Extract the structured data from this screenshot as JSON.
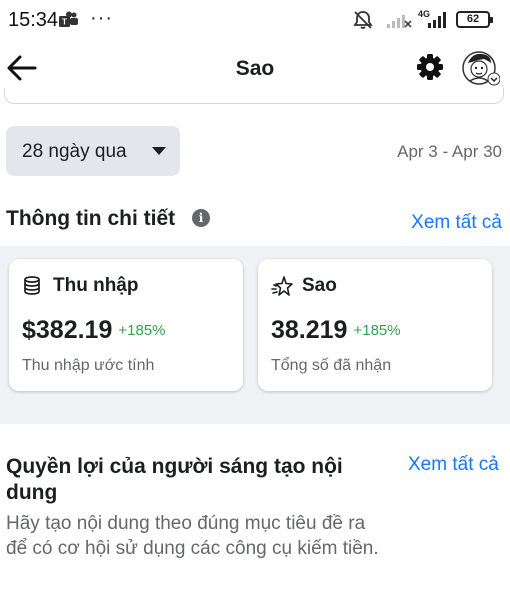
{
  "status_bar": {
    "time": "15:34",
    "dots": "···",
    "network": "4G",
    "battery": "62"
  },
  "header": {
    "title": "Sao",
    "icons": [
      "back-arrow-icon",
      "gear-icon",
      "avatar"
    ]
  },
  "filter": {
    "period_label": "28 ngày qua",
    "date_range": "Apr 3 - Apr 30"
  },
  "insights": {
    "title": "Thông tin chi tiết",
    "info_icon": "i",
    "see_all": "Xem tất cả",
    "cards": [
      {
        "icon": "money-stack-icon",
        "title": "Thu nhập",
        "value": "$382.19",
        "delta": "+185%",
        "subtitle": "Thu nhập ước tính"
      },
      {
        "icon": "star-icon",
        "title": "Sao",
        "value": "38.219",
        "delta": "+185%",
        "subtitle": "Tổng số đã nhận"
      }
    ]
  },
  "benefits": {
    "title": "Quyền lợi của người sáng tạo nội dung",
    "see_all": "Xem tất cả",
    "description": "Hãy tạo nội dung theo đúng mục tiêu đề ra để có cơ hội sử dụng các công cụ kiếm tiền."
  },
  "colors": {
    "link": "#1877f2",
    "positive": "#31a24c",
    "secondary_text": "#65676b",
    "chip_bg": "#e4e6eb",
    "section_bg": "#f0f2f5"
  }
}
